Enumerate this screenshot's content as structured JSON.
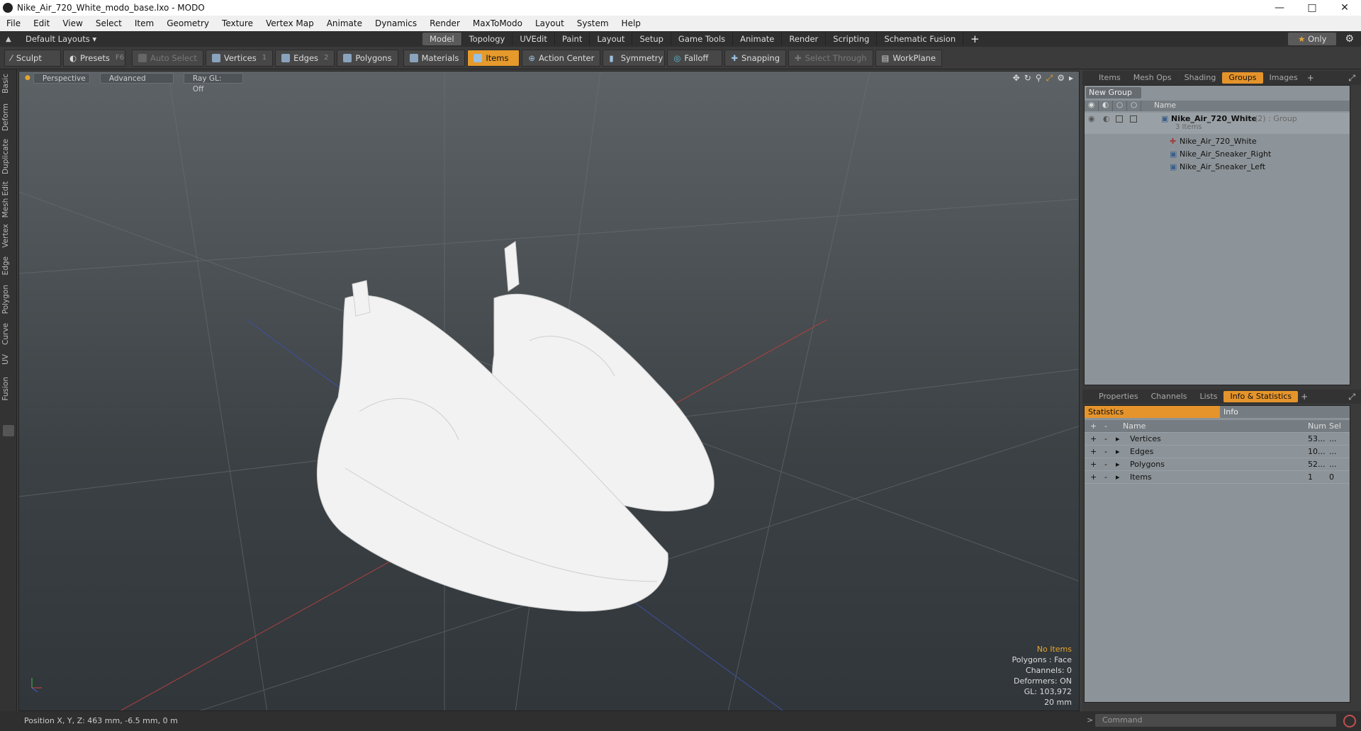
{
  "window": {
    "title": "Nike_Air_720_White_modo_base.lxo - MODO"
  },
  "menu": [
    "File",
    "Edit",
    "View",
    "Select",
    "Item",
    "Geometry",
    "Texture",
    "Vertex Map",
    "Animate",
    "Dynamics",
    "Render",
    "MaxToModo",
    "Layout",
    "System",
    "Help"
  ],
  "layouts": {
    "selector": "Default Layouts",
    "tabs": [
      "Model",
      "Topology",
      "UVEdit",
      "Paint",
      "Layout",
      "Setup",
      "Game Tools",
      "Animate",
      "Render",
      "Scripting",
      "Schematic Fusion"
    ],
    "active": "Model",
    "only_label": "Only"
  },
  "toolbar": {
    "sculpt": "Sculpt",
    "presets": "Presets",
    "presets_shortcut": "F6",
    "auto_select": "Auto Select",
    "vertices": "Vertices",
    "vertices_count": "1",
    "edges": "Edges",
    "edges_count": "2",
    "polygons": "Polygons",
    "materials": "Materials",
    "items": "Items",
    "action_center": "Action Center",
    "symmetry": "Symmetry",
    "falloff": "Falloff",
    "snapping": "Snapping",
    "select_through": "Select Through",
    "workplane": "WorkPlane"
  },
  "left_tabs": [
    "Basic",
    "Deform",
    "Duplicate",
    "Mesh Edit",
    "Vertex",
    "Edge",
    "Polygon",
    "Curve",
    "UV",
    "Fusion"
  ],
  "viewport": {
    "view": "Perspective",
    "shading": "Advanced",
    "raygl": "Ray GL: Off",
    "info": {
      "no_items": "No Items",
      "polygons": "Polygons : Face",
      "channels": "Channels: 0",
      "deformers": "Deformers: ON",
      "gl": "GL: 103,972",
      "scale": "20 mm"
    }
  },
  "status": {
    "position": "Position X, Y, Z:  463 mm, -6.5 mm, 0 m"
  },
  "groups_panel": {
    "tabs": [
      "Items",
      "Mesh Ops",
      "Shading",
      "Groups",
      "Images"
    ],
    "active": "Groups",
    "new_group": "New Group",
    "name_header": "Name",
    "group_name": "Nike_Air_720_White",
    "group_suffix": "(2) : Group",
    "group_count": "3 Items",
    "children": [
      "Nike_Air_720_White",
      "Nike_Air_Sneaker_Right",
      "Nike_Air_Sneaker_Left"
    ]
  },
  "stats_panel": {
    "tabs": [
      "Properties",
      "Channels",
      "Lists",
      "Info & Statistics"
    ],
    "active": "Info & Statistics",
    "subtabs": [
      "Statistics",
      "Info"
    ],
    "headers": {
      "name": "Name",
      "num": "Num",
      "sel": "Sel"
    },
    "rows": [
      {
        "name": "Vertices",
        "num": "53...",
        "sel": "..."
      },
      {
        "name": "Edges",
        "num": "10...",
        "sel": "..."
      },
      {
        "name": "Polygons",
        "num": "52...",
        "sel": "..."
      },
      {
        "name": "Items",
        "num": "1",
        "sel": "0"
      }
    ]
  },
  "command": {
    "placeholder": "Command"
  },
  "colors": {
    "accent": "#e5942b",
    "panel": "#8d9499"
  }
}
